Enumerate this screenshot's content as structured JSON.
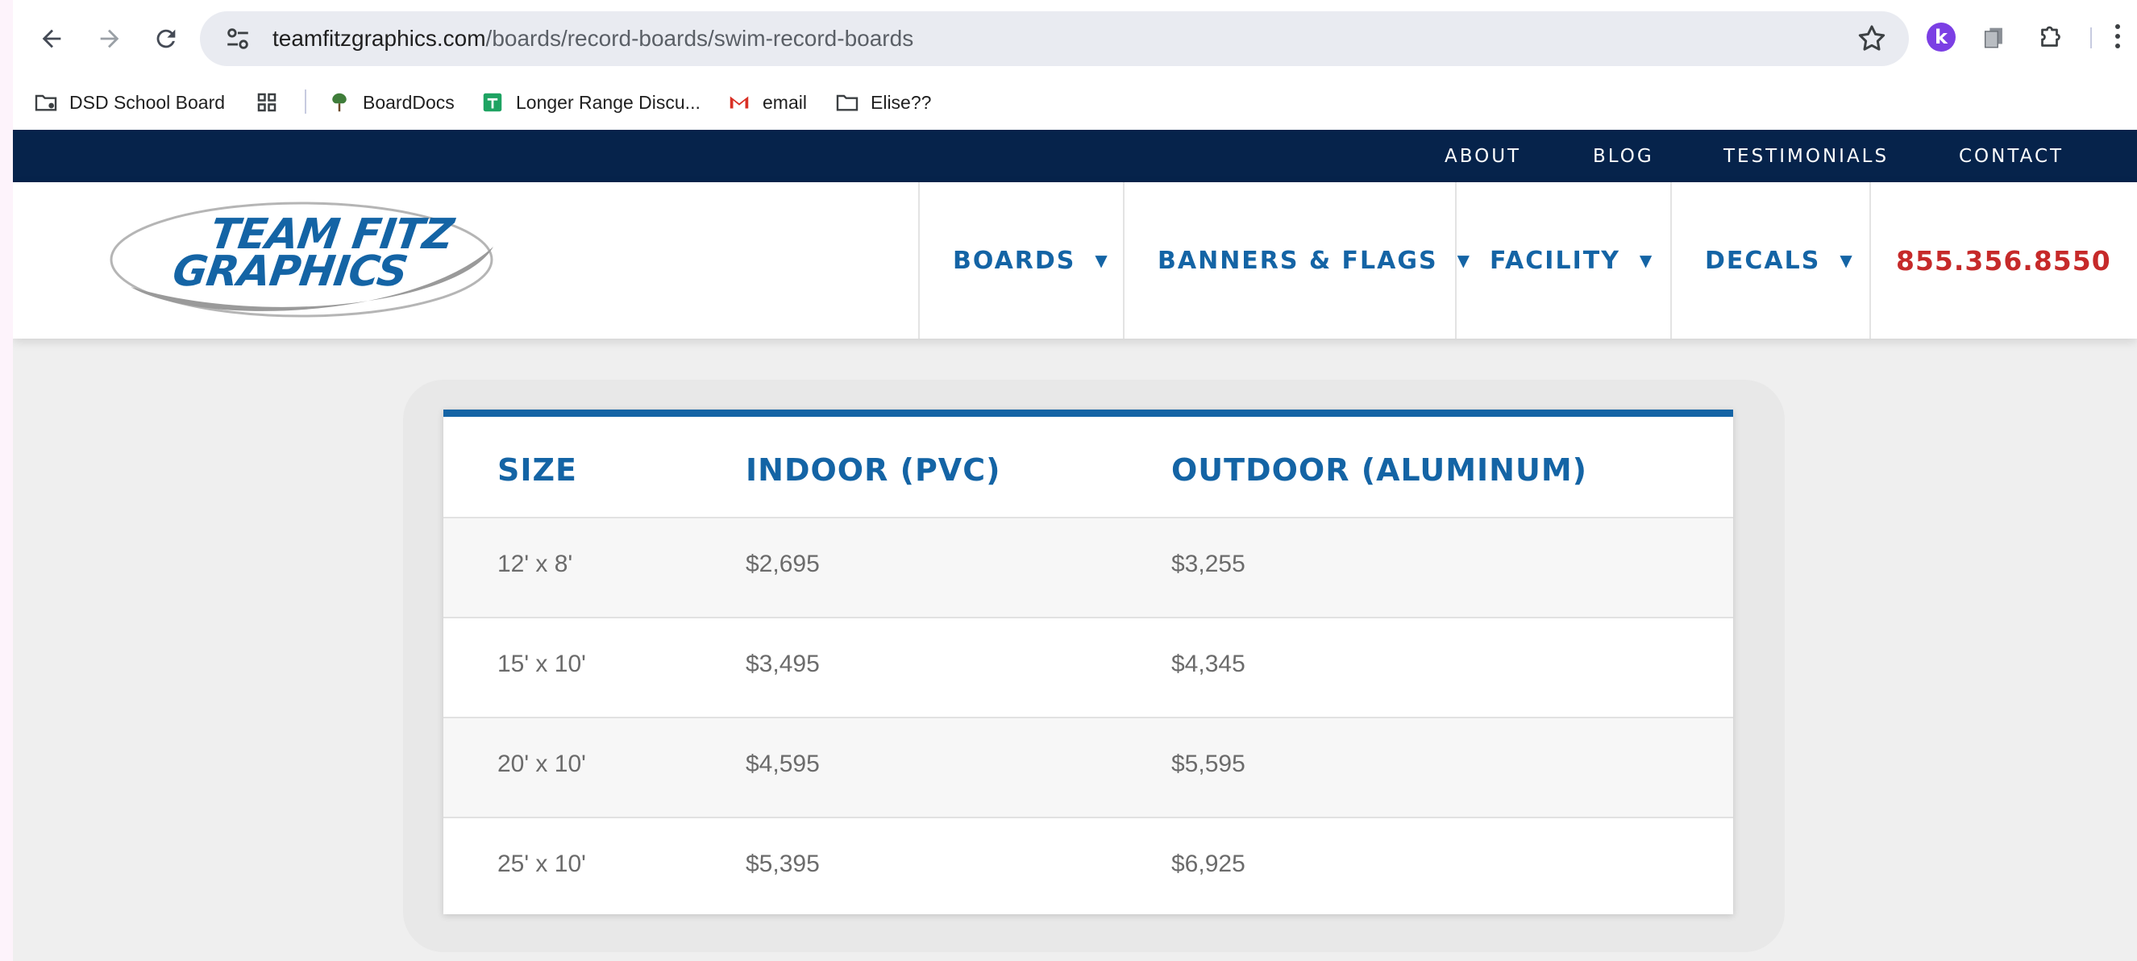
{
  "browser": {
    "url_domain": "teamfitzgraphics.com",
    "url_path": "/boards/record-boards/swim-record-boards",
    "bookmarks": [
      {
        "label": "DSD School Board",
        "icon": "folder-shared-icon"
      },
      {
        "label": "",
        "icon": "apps-grid-icon"
      },
      {
        "label": "BoardDocs",
        "icon": "tree-icon"
      },
      {
        "label": "Longer Range Discu...",
        "icon": "sheets-icon"
      },
      {
        "label": "email",
        "icon": "gmail-icon"
      },
      {
        "label": "Elise??",
        "icon": "folder-icon"
      }
    ],
    "extension_k": "k"
  },
  "site": {
    "topbar_links": [
      "ABOUT",
      "BLOG",
      "TESTIMONIALS",
      "CONTACT"
    ],
    "logo": {
      "line1": "TEAM FITZ",
      "line2": "GRAPHICS"
    },
    "nav": [
      {
        "label": "BOARDS",
        "caret": "▼"
      },
      {
        "label": "BANNERS & FLAGS",
        "caret": "▼"
      },
      {
        "label": "FACILITY",
        "caret": "▼"
      },
      {
        "label": "DECALS",
        "caret": "▼"
      }
    ],
    "phone": "855.356.8550",
    "colors": {
      "navy": "#06234b",
      "brand_blue": "#1464a5",
      "phone_red": "#c62a2a"
    }
  },
  "price_table": {
    "headers": [
      "SIZE",
      "INDOOR (PVC)",
      "OUTDOOR (ALUMINUM)"
    ],
    "rows": [
      [
        "12' x 8'",
        "$2,695",
        "$3,255"
      ],
      [
        "15' x 10'",
        "$3,495",
        "$4,345"
      ],
      [
        "20' x 10'",
        "$4,595",
        "$5,595"
      ],
      [
        "25' x 10'",
        "$5,395",
        "$6,925"
      ]
    ]
  }
}
